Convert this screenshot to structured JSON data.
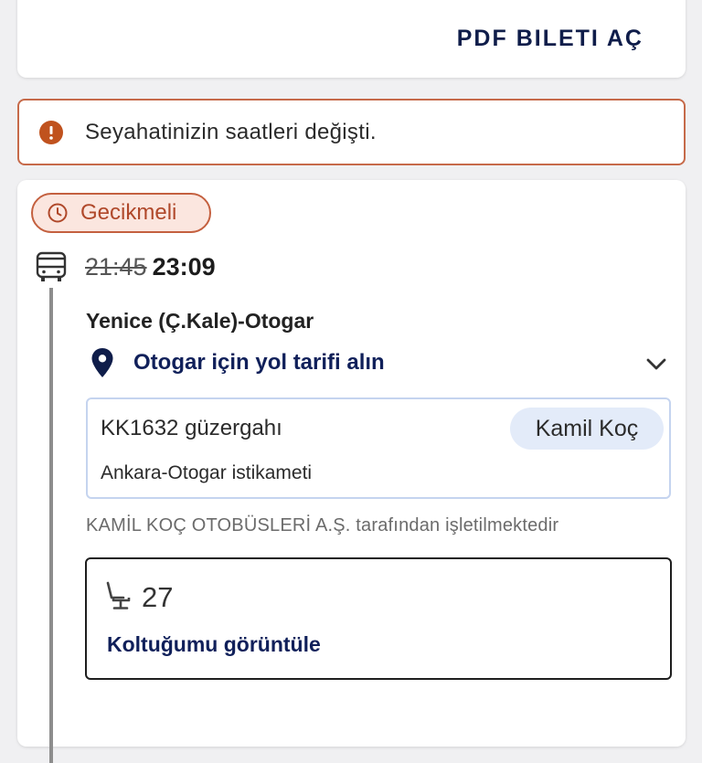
{
  "top_card": {
    "pdf_button_label": "PDF BILETI AÇ"
  },
  "alert": {
    "icon": "info-icon",
    "message": "Seyahatinizin saatleri değişti.",
    "border_color": "#c66a4a"
  },
  "trip": {
    "status_badge": {
      "icon": "clock-icon",
      "label": "Gecikmeli",
      "color": "#c4603f"
    },
    "departure": {
      "icon": "bus-icon",
      "original_time": "21:45",
      "new_time": "23:09"
    },
    "stop_name": "Yenice (Ç.Kale)-Otogar",
    "directions": {
      "icon": "map-pin-icon",
      "label": "Otogar için yol tarifi alın",
      "expand_icon": "chevron-down-icon"
    },
    "route": {
      "code": "KK1632 güzergahı",
      "company": "Kamil Koç",
      "destination": "Ankara-Otogar istikameti"
    },
    "operator_text": "KAMİL KOÇ OTOBÜSLERİ A.Ş. tarafından işletilmektedir",
    "seat": {
      "icon": "seat-icon",
      "number": "27",
      "view_label": "Koltuğumu görüntüle"
    }
  }
}
